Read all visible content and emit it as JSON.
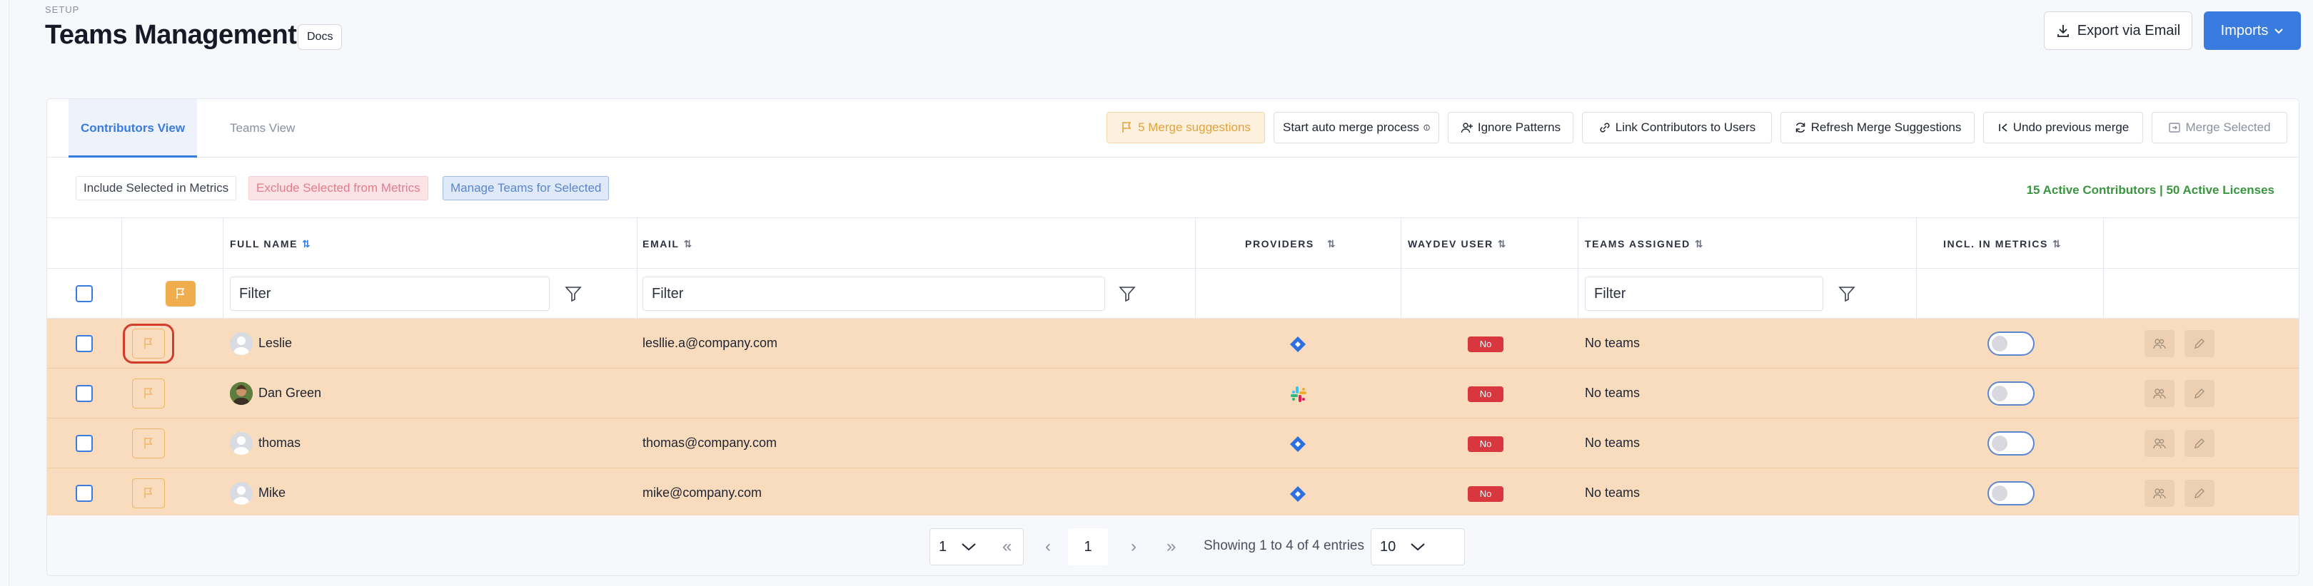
{
  "header": {
    "section": "SETUP",
    "title": "Teams Management",
    "docs_label": "Docs",
    "export_label": "Export via Email",
    "imports_label": "Imports"
  },
  "tabs": [
    {
      "label": "Contributors View",
      "active": true
    },
    {
      "label": "Teams View",
      "active": false
    }
  ],
  "toolbar": {
    "merge_suggestions": "5 Merge suggestions",
    "auto_merge": "Start auto merge process",
    "ignore_patterns": "Ignore Patterns",
    "link_contributors": "Link Contributors to Users",
    "refresh_suggestions": "Refresh Merge Suggestions",
    "undo_merge": "Undo previous merge",
    "merge_selected": "Merge Selected"
  },
  "bulk_actions": {
    "include": "Include Selected in Metrics",
    "exclude": "Exclude Selected from Metrics",
    "manage": "Manage Teams for Selected",
    "licenses": "15 Active Contributors | 50 Active Licenses"
  },
  "columns": {
    "full_name": "FULL NAME",
    "email": "EMAIL",
    "providers": "PROVIDERS",
    "waydev_user": "WAYDEV USER",
    "teams_assigned": "TEAMS ASSIGNED",
    "incl_metrics": "INCL. IN METRICS"
  },
  "filters": {
    "name_placeholder": "Filter",
    "email_placeholder": "Filter",
    "teams_placeholder": "Filter"
  },
  "rows": [
    {
      "name": "Leslie",
      "email": "lesllie.a@company.com",
      "provider": "jira",
      "waydev": "No",
      "teams": "No teams",
      "included": false
    },
    {
      "name": "Dan Green",
      "email": "",
      "provider": "slack",
      "waydev": "No",
      "teams": "No teams",
      "included": false
    },
    {
      "name": "thomas",
      "email": "thomas@company.com",
      "provider": "jira",
      "waydev": "No",
      "teams": "No teams",
      "included": false
    },
    {
      "name": "Mike",
      "email": "mike@company.com",
      "provider": "jira",
      "waydev": "No",
      "teams": "No teams",
      "included": false
    }
  ],
  "pagination": {
    "page_select": "1",
    "first": "«",
    "prev": "‹",
    "current": "1",
    "next": "›",
    "last": "»",
    "info": "Showing 1 to 4 of 4 entries",
    "page_size": "10"
  },
  "colors": {
    "accent": "#3a7be0",
    "row_highlight": "#f8dcbd",
    "flag": "#f0ad4e",
    "no_badge": "#d9373f",
    "licenses": "#3b9440"
  }
}
